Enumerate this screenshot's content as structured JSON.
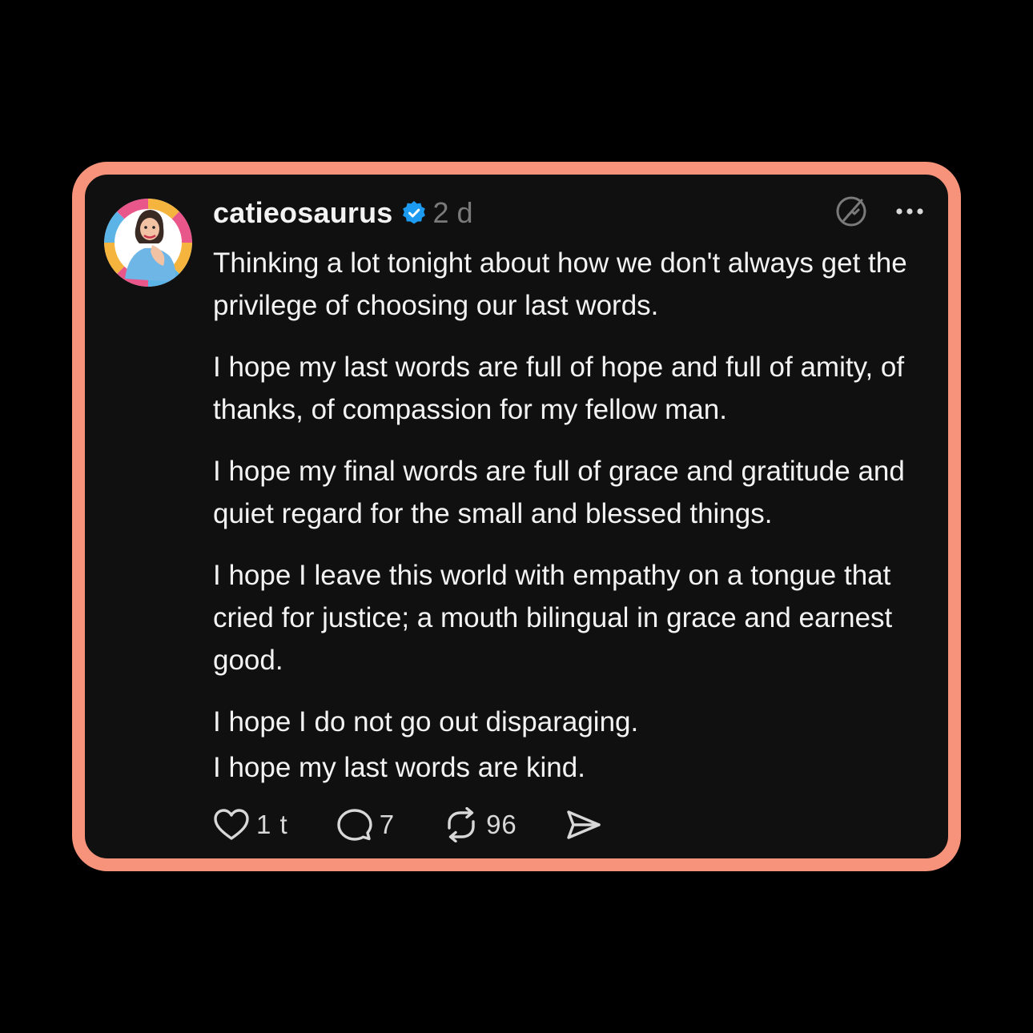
{
  "post": {
    "username": "catieosaurus",
    "verified": true,
    "timestamp": "2 d",
    "paragraphs": [
      "Thinking a lot tonight about how we don't always get the privilege of choosing our last words.",
      "I hope my last words are full of hope and full of amity, of thanks, of compassion for my fellow man.",
      "I hope my final words are full of grace and gratitude and quiet regard for the small and blessed things.",
      "I hope I leave this world with empathy on a tongue that cried for justice; a mouth bilingual in grace and earnest good.",
      "I hope I do not go out disparaging.",
      "I hope my last words are kind."
    ],
    "actions": {
      "likes": "1 t",
      "comments": "7",
      "reposts": "96"
    }
  },
  "icons": {
    "header": [
      "verified-badge-icon",
      "repost-off-icon",
      "more-icon"
    ],
    "actions": [
      "heart-icon",
      "comment-icon",
      "repost-icon",
      "share-icon"
    ]
  },
  "colors": {
    "frame": "#F7937A",
    "card_background": "#101010",
    "page_background": "#000000",
    "verified_blue": "#1D9BF0",
    "text": "#F3F3F3",
    "muted": "#7A7A7A"
  }
}
